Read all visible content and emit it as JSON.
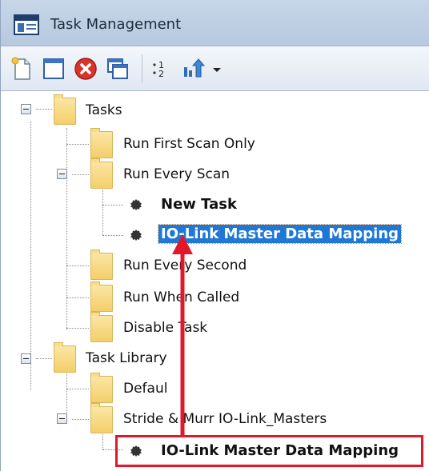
{
  "window": {
    "title": "Task Management"
  },
  "toolbar": {
    "buttons": [
      {
        "name": "new-document-icon"
      },
      {
        "name": "window-icon"
      },
      {
        "name": "delete-icon"
      },
      {
        "name": "copy-windows-icon"
      },
      {
        "name": "sort-order-icon"
      },
      {
        "name": "move-up-icon"
      },
      {
        "name": "dropdown-arrow-icon"
      }
    ]
  },
  "tree": {
    "tasks_label": "Tasks",
    "run_first_scan_label": "Run First Scan Only",
    "run_every_scan_label": "Run Every Scan",
    "new_task_label": "New Task",
    "io_link_selected_label": "IO-Link Master Data Mapping",
    "run_every_second_label": "Run Every Second",
    "run_when_called_label": "Run When Called",
    "disable_task_label": "Disable Task",
    "task_library_label": "Task Library",
    "default_label": "Defaul",
    "stride_label": "Stride & Murr IO-Link_Masters",
    "io_link_library_label": "IO-Link Master Data Mapping"
  },
  "annotation": {
    "arrow_color": "#e2182a",
    "box_color": "#e2182a"
  }
}
